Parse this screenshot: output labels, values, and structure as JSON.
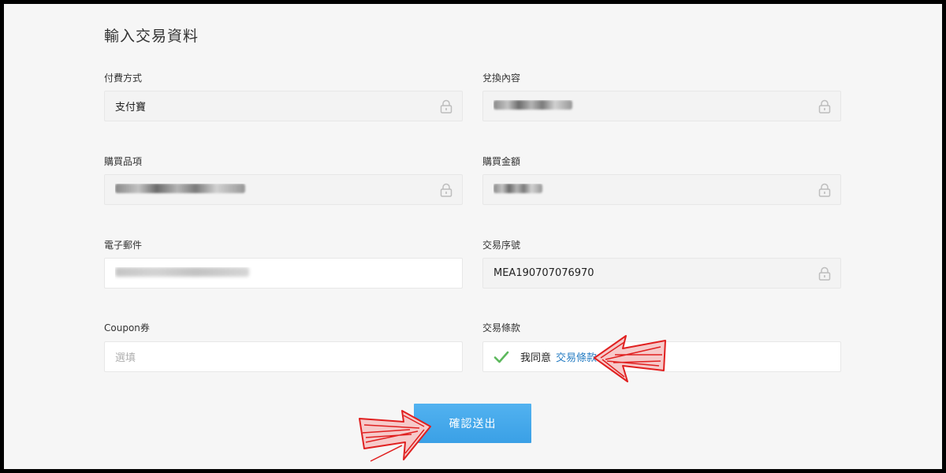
{
  "section_title": "輸入交易資料",
  "fields": {
    "payment_method": {
      "label": "付費方式",
      "value": "支付寶"
    },
    "redeem_content": {
      "label": "兌換內容",
      "value": ""
    },
    "purchase_item": {
      "label": "購買品項",
      "value": ""
    },
    "purchase_amount": {
      "label": "購買金額",
      "value": ""
    },
    "email": {
      "label": "電子郵件",
      "value": ""
    },
    "transaction_no": {
      "label": "交易序號",
      "value": "MEA190707076970"
    },
    "coupon": {
      "label": "Coupon券",
      "placeholder": "選填"
    },
    "terms": {
      "label": "交易條款",
      "agree_text": "我同意",
      "link_text": "交易條款"
    }
  },
  "submit_label": "確認送出",
  "icons": {
    "lock": "lock-icon",
    "check": "check-icon",
    "arrow": "red-arrow-annotation"
  },
  "colors": {
    "accent": "#3aa0e6",
    "link": "#2a7fc4",
    "check": "#5cb85c",
    "annotation": "#e02020"
  }
}
